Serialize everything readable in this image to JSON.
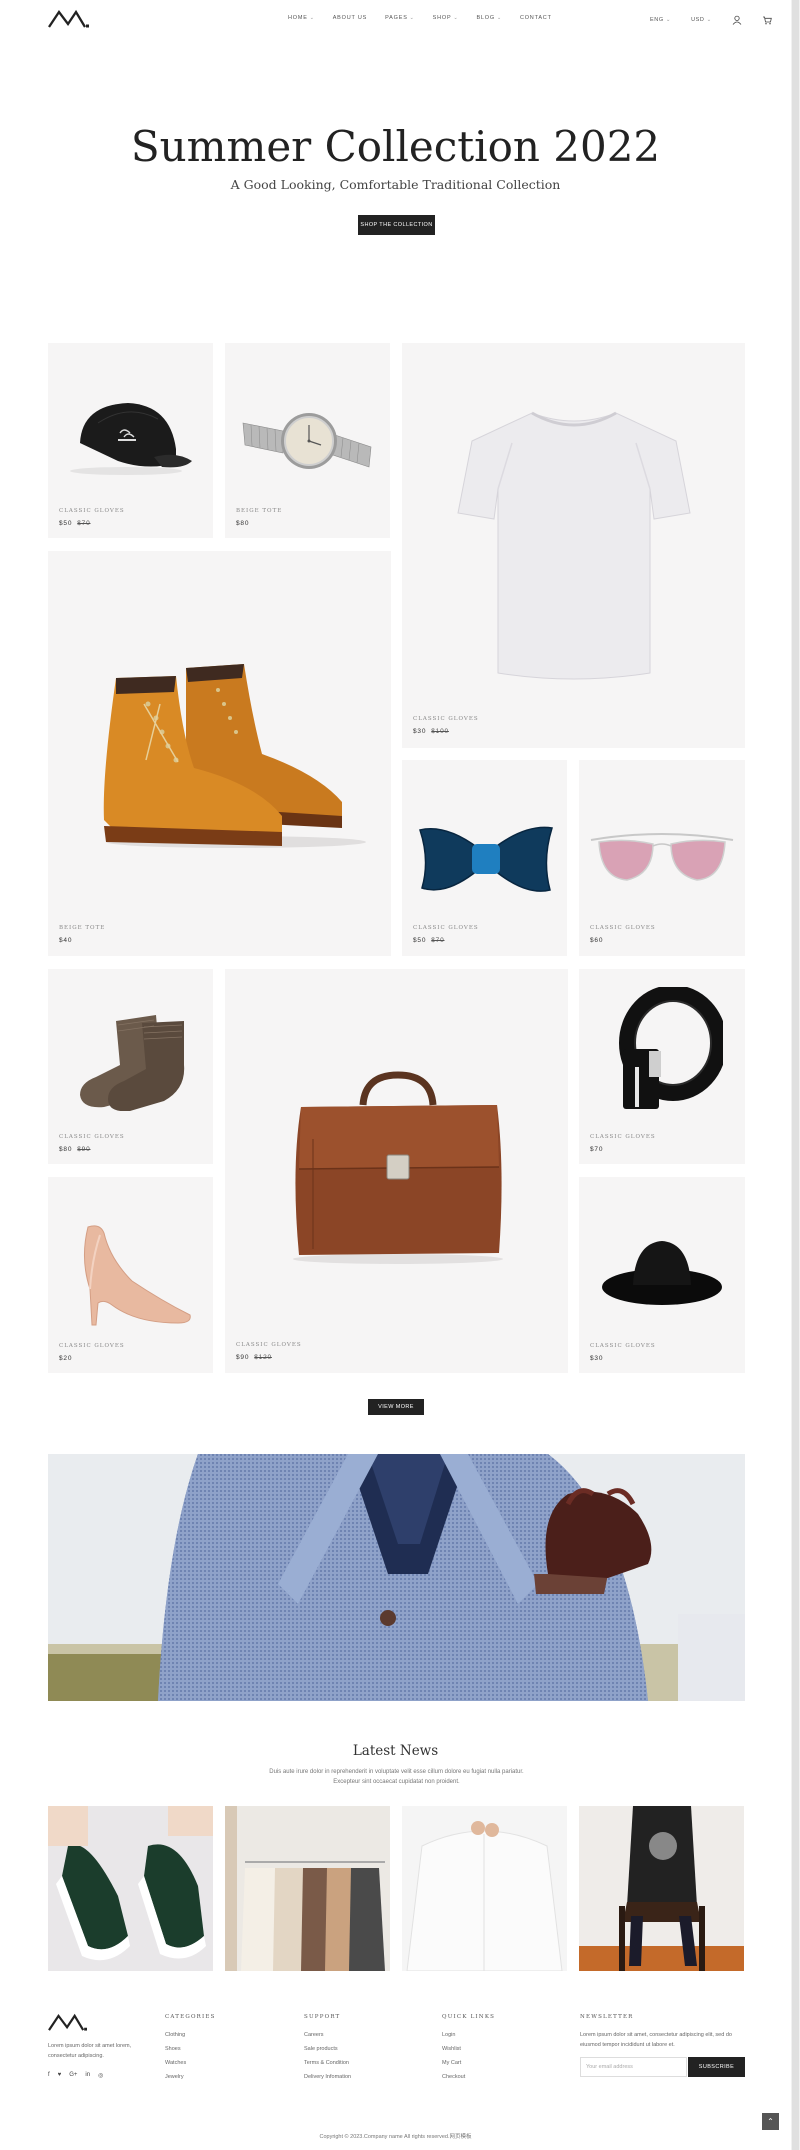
{
  "header": {
    "nav": [
      {
        "label": "HOME",
        "caret": true
      },
      {
        "label": "ABOUT US",
        "caret": false
      },
      {
        "label": "PAGES",
        "caret": true
      },
      {
        "label": "SHOP",
        "caret": true
      },
      {
        "label": "BLOG",
        "caret": true
      },
      {
        "label": "CONTACT",
        "caret": false
      }
    ],
    "language": "ENG",
    "currency": "USD",
    "icons": [
      "user-icon",
      "cart-icon"
    ]
  },
  "hero": {
    "title": "Summer Collection 2022",
    "subtitle": "A Good Looking, Comfortable Traditional Collection",
    "button": "SHOP THE COLLECTION"
  },
  "products": [
    {
      "id": "cap",
      "name": "CLASSIC GLOVES",
      "price": "$50",
      "old_price": "$70"
    },
    {
      "id": "watch",
      "name": "BEIGE TOTE",
      "price": "$80",
      "old_price": ""
    },
    {
      "id": "tshirt",
      "name": "CLASSIC GLOVES",
      "price": "$30",
      "old_price": "$100"
    },
    {
      "id": "boots",
      "name": "BEIGE TOTE",
      "price": "$40",
      "old_price": ""
    },
    {
      "id": "bowtie",
      "name": "CLASSIC GLOVES",
      "price": "$50",
      "old_price": "$70"
    },
    {
      "id": "sunglasses",
      "name": "CLASSIC GLOVES",
      "price": "$60",
      "old_price": ""
    },
    {
      "id": "socks",
      "name": "CLASSIC GLOVES",
      "price": "$80",
      "old_price": "$90"
    },
    {
      "id": "briefcase",
      "name": "CLASSIC GLOVES",
      "price": "$90",
      "old_price": "$120"
    },
    {
      "id": "belt",
      "name": "CLASSIC GLOVES",
      "price": "$70",
      "old_price": ""
    },
    {
      "id": "heels",
      "name": "CLASSIC GLOVES",
      "price": "$20",
      "old_price": ""
    },
    {
      "id": "hat",
      "name": "CLASSIC GLOVES",
      "price": "$30",
      "old_price": ""
    }
  ],
  "view_more": "VIEW MORE",
  "news": {
    "title": "Latest News",
    "description": "Duis aute irure dolor in reprehenderit in voluptate velit esse cillum dolore eu fugiat nulla pariatur. Excepteur sint occaecat cupidatat non proident."
  },
  "footer": {
    "about": "Lorem ipsum dolor sit amet lorem, consectetur adipiscing.",
    "social": [
      "facebook-icon",
      "twitter-icon",
      "google-plus-icon",
      "linkedin-icon",
      "instagram-icon"
    ],
    "categories": {
      "title": "CATEGORIES",
      "links": [
        "Clothing",
        "Shoes",
        "Watches",
        "Jewelry"
      ]
    },
    "support": {
      "title": "SUPPORT",
      "links": [
        "Careers",
        "Sale products",
        "Terms & Condition",
        "Delivery Infomation"
      ]
    },
    "quick_links": {
      "title": "QUICK LINKS",
      "links": [
        "Login",
        "Wishlist",
        "My Cart",
        "Checkout"
      ]
    },
    "newsletter": {
      "title": "NEWSLETTER",
      "text": "Lorem ipsum dolor sit amet, consectetur adipiscing elit, sed do eiusmod tempor incididunt ut labore et.",
      "placeholder": "Your email address",
      "button": "SUBSCRIBE"
    },
    "copyright": "Copyright © 2023.Company name All rights reserved.网页模板"
  },
  "colors": {
    "dark": "#222222",
    "card_bg": "#f6f5f5",
    "text": "#333333"
  }
}
